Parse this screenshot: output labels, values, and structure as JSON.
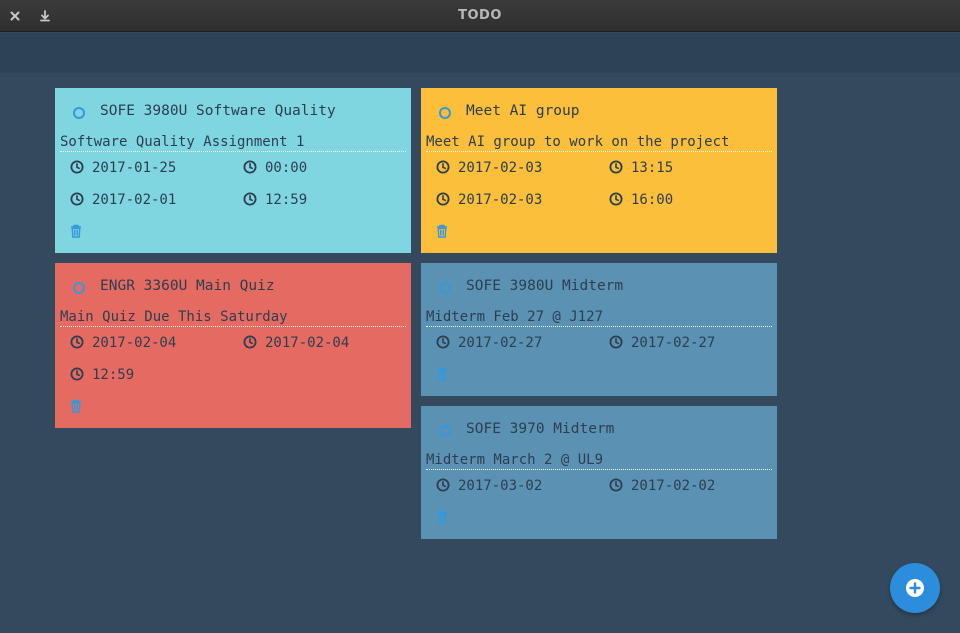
{
  "window": {
    "title": "TODO"
  },
  "colors": {
    "background": "#34495e",
    "header": "#2e4257",
    "teal": "#7fd6e0",
    "yellow": "#fbbf3b",
    "red": "#e56b62",
    "blue": "#5b92b3",
    "accent": "#3498db",
    "fab": "#2b8ddb"
  },
  "cards": [
    {
      "title": "SOFE 3980U Software Quality",
      "description": "Software Quality Assignment 1",
      "start_date": "2017-01-25",
      "start_time": "00:00",
      "end_date": "2017-02-01",
      "end_time": "12:59",
      "color": "teal"
    },
    {
      "title": "Meet AI group",
      "description": "Meet AI group to work on the project",
      "start_date": "2017-02-03",
      "start_time": "13:15",
      "end_date": "2017-02-03",
      "end_time": "16:00",
      "color": "yellow"
    },
    {
      "title": "ENGR 3360U Main Quiz",
      "description": "Main Quiz Due This Saturday",
      "start_date": "2017-02-04",
      "end_date": "2017-02-04",
      "time": "12:59",
      "color": "red"
    },
    {
      "title": "SOFE 3980U Midterm",
      "description": "Midterm Feb 27 @ J127",
      "start_date": "2017-02-27",
      "end_date": "2017-02-27",
      "color": "blue"
    },
    {
      "title": "SOFE 3970 Midterm",
      "description": "Midterm March 2 @ UL9",
      "start_date": "2017-03-02",
      "end_date": "2017-02-02",
      "color": "blue"
    }
  ],
  "icons": {
    "close": "close-icon",
    "download": "download-icon",
    "clock": "clock-icon",
    "trash": "trash-icon",
    "add": "add-circle-icon"
  }
}
